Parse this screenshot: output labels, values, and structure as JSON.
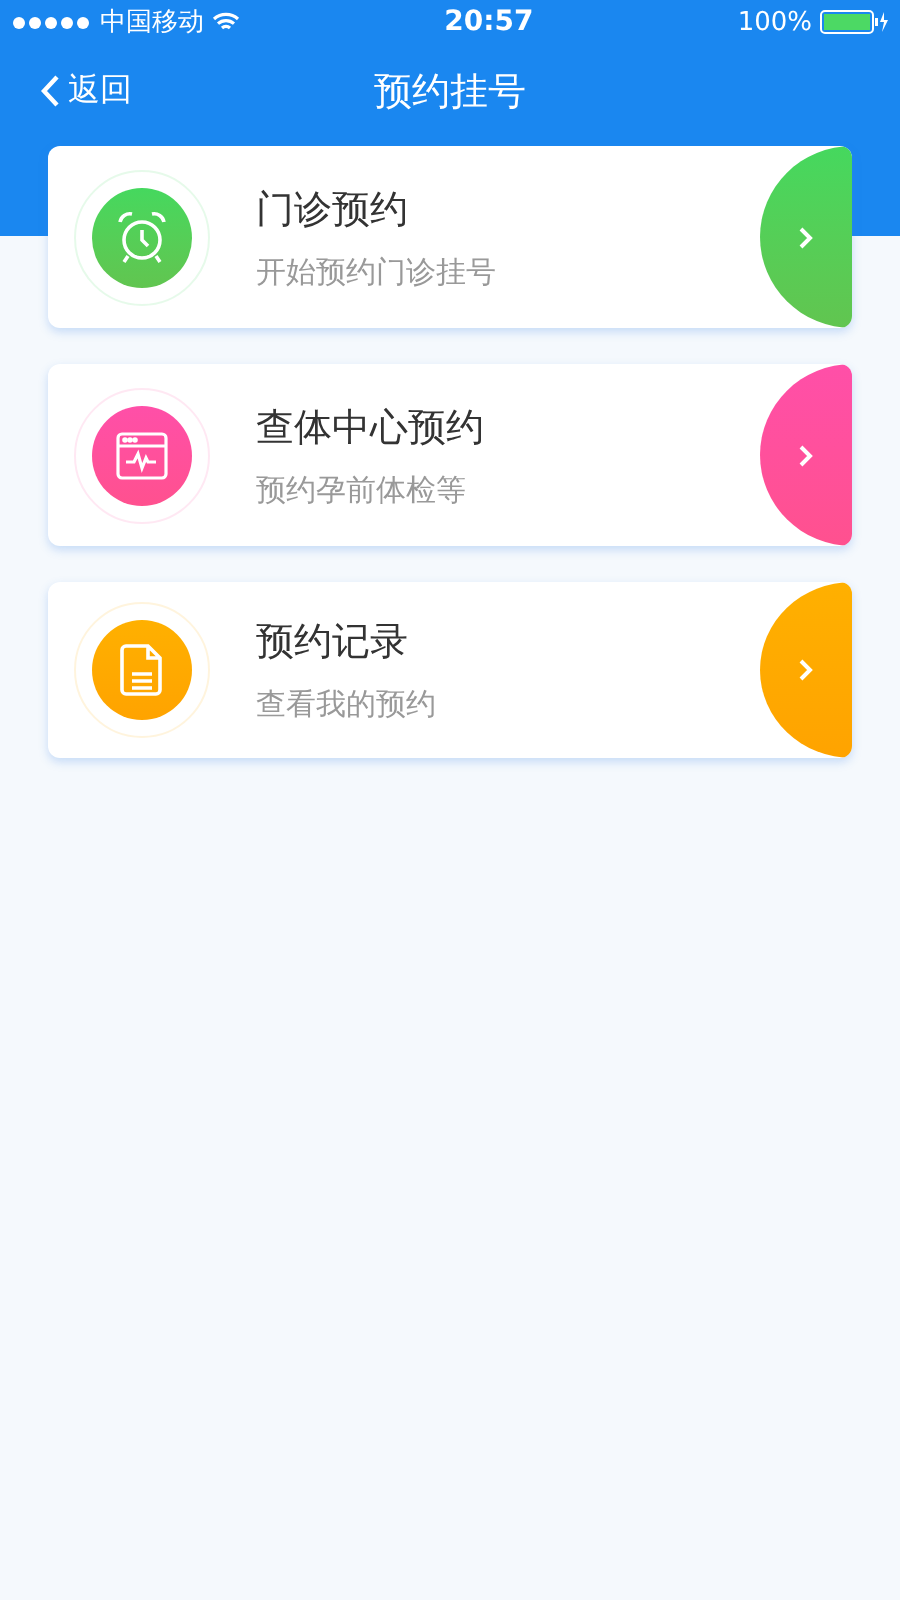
{
  "status_bar": {
    "carrier": "中国移动",
    "time": "20:57",
    "battery": "100%"
  },
  "nav": {
    "back": "返回",
    "title": "预约挂号"
  },
  "cards": [
    {
      "kind": "alarm",
      "title": "门诊预约",
      "subtitle": "开始预约门诊挂号",
      "color": "#45d85e"
    },
    {
      "kind": "monitor",
      "title": "查体中心预约",
      "subtitle": "预约孕前体检等",
      "color": "#ff4fa8"
    },
    {
      "kind": "document",
      "title": "预约记录",
      "subtitle": "查看我的预约",
      "color": "#ffb000"
    }
  ]
}
